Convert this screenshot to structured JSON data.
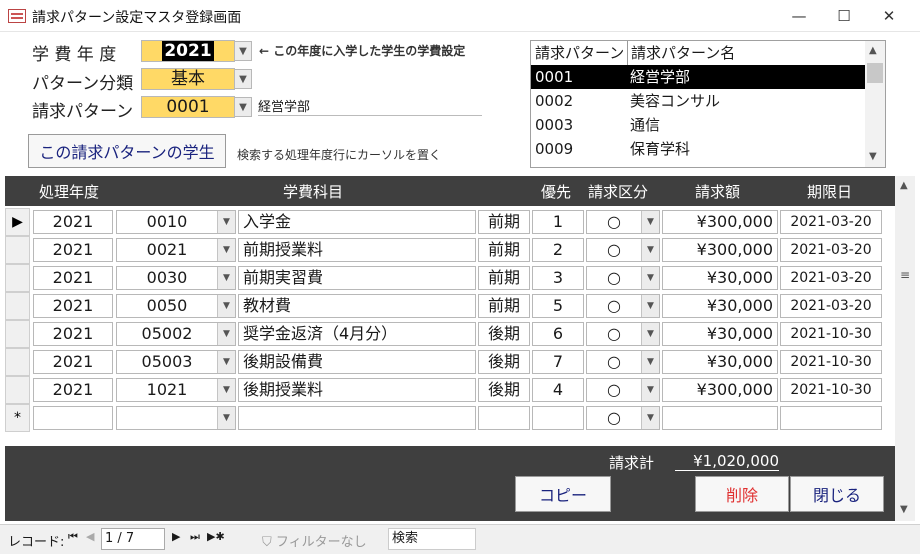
{
  "window": {
    "title": "請求パターン設定マスタ登録画面",
    "minimize": "—",
    "maximize": "☐",
    "close": "✕"
  },
  "form": {
    "year_label": "学 費 年 度",
    "year_value": "2021",
    "year_note": "← この年度に入学した学生の学費設定",
    "category_label": "パターン分類",
    "category_value": "基本",
    "pattern_label": "請求パターン",
    "pattern_value": "0001",
    "pattern_name": "経営学部",
    "students_button": "この請求パターンの学生",
    "search_note": "検索する処理年度行にカーソルを置く"
  },
  "listbox": {
    "headers": [
      "請求パターン",
      "請求パターン名"
    ],
    "rows": [
      {
        "code": "0001",
        "name": "経営学部",
        "selected": true
      },
      {
        "code": "0002",
        "name": "美容コンサル"
      },
      {
        "code": "0003",
        "name": "通信"
      },
      {
        "code": "0009",
        "name": "保育学科"
      }
    ]
  },
  "grid": {
    "headers": [
      "処理年度",
      "学費科目",
      "優先",
      "請求区分",
      "請求額",
      "期限日"
    ],
    "rows": [
      {
        "year": "2021",
        "code": "0010",
        "name": "入学金",
        "term": "前期",
        "priority": "1",
        "division": "○",
        "amount": "¥300,000",
        "due": "2021-03-20"
      },
      {
        "year": "2021",
        "code": "0021",
        "name": "前期授業料",
        "term": "前期",
        "priority": "2",
        "division": "○",
        "amount": "¥300,000",
        "due": "2021-03-20"
      },
      {
        "year": "2021",
        "code": "0030",
        "name": "前期実習費",
        "term": "前期",
        "priority": "3",
        "division": "○",
        "amount": "¥30,000",
        "due": "2021-03-20"
      },
      {
        "year": "2021",
        "code": "0050",
        "name": "教材費",
        "term": "前期",
        "priority": "5",
        "division": "○",
        "amount": "¥30,000",
        "due": "2021-03-20"
      },
      {
        "year": "2021",
        "code": "05002",
        "name": "奨学金返済（4月分）",
        "term": "後期",
        "priority": "6",
        "division": "○",
        "amount": "¥30,000",
        "due": "2021-10-30"
      },
      {
        "year": "2021",
        "code": "05003",
        "name": "後期設備費",
        "term": "後期",
        "priority": "7",
        "division": "○",
        "amount": "¥30,000",
        "due": "2021-10-30"
      },
      {
        "year": "2021",
        "code": "1021",
        "name": "後期授業料",
        "term": "後期",
        "priority": "4",
        "division": "○",
        "amount": "¥300,000",
        "due": "2021-10-30"
      }
    ],
    "new_row_marker": "*",
    "new_row_division": "○",
    "current_row_marker": "▶"
  },
  "footer": {
    "total_label": "請求計",
    "total_value": "¥1,020,000",
    "copy_button": "コピー",
    "delete_button": "削除",
    "close_button": "閉じる"
  },
  "navbar": {
    "record_label": "レコード:",
    "record_position": "1 / 7",
    "filter_label": "フィルターなし",
    "search_label": "検索"
  },
  "colors": {
    "highlight": "#ffd966",
    "header_bg": "#3f3f3f",
    "delete_text": "#e03030",
    "button_text": "#1a237e"
  }
}
